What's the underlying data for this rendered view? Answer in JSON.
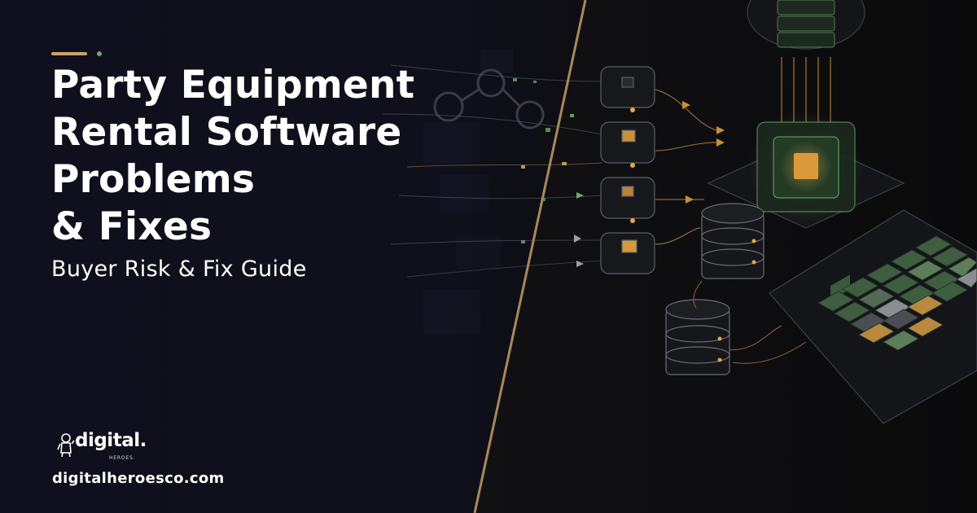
{
  "headline": {
    "lines": [
      "Party Equipment",
      "Rental Software",
      "Problems",
      "& Fixes"
    ]
  },
  "subheadline": "Buyer Risk & Fix Guide",
  "brand": {
    "name": "digital.",
    "tagline": "HEROES.",
    "icon": "hero-mascot-icon"
  },
  "website": "digitalheroesco.com",
  "colors": {
    "background": "#0f0f1d",
    "accent_gold": "#c9a46a",
    "accent_green": "#6fa86a",
    "divider": "#a8885a"
  }
}
